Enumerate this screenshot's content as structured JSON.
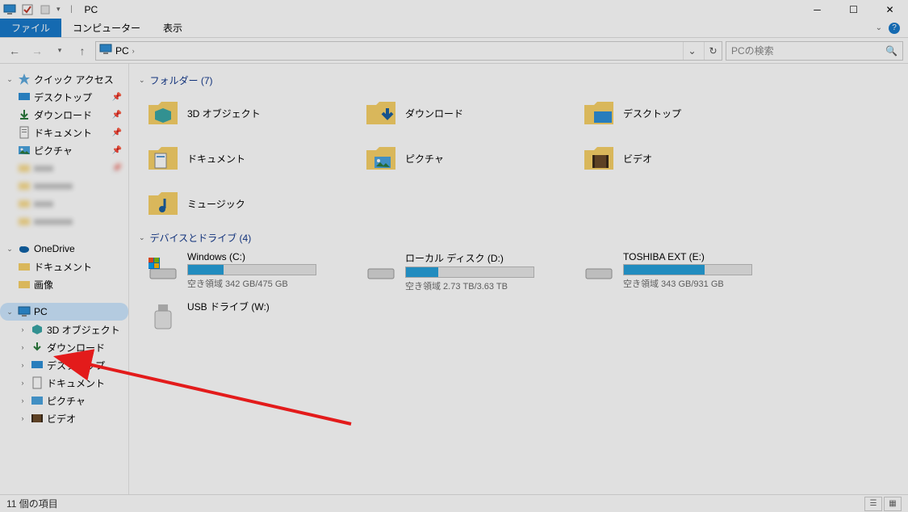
{
  "window": {
    "title": "PC"
  },
  "ribbon": {
    "file": "ファイル",
    "computer": "コンピューター",
    "view": "表示"
  },
  "nav": {
    "breadcrumb_root": "PC",
    "search_placeholder": "PCの検索"
  },
  "sidebar": {
    "quick_access": "クイック アクセス",
    "desktop": "デスクトップ",
    "downloads": "ダウンロード",
    "documents": "ドキュメント",
    "pictures": "ピクチャ",
    "blur1": "xxxx",
    "blur2": "xxxxxxxx",
    "blur3": "xxxx",
    "blur4": "xxxxxxxx",
    "onedrive": "OneDrive",
    "od_documents": "ドキュメント",
    "od_images": "画像",
    "pc": "PC",
    "pc_3d": "3D オブジェクト",
    "pc_downloads": "ダウンロード",
    "pc_desktop": "デスクトップ",
    "pc_documents": "ドキュメント",
    "pc_pictures": "ピクチャ",
    "pc_videos": "ビデオ"
  },
  "groups": {
    "folders": {
      "label": "フォルダー (7)"
    },
    "devices": {
      "label": "デバイスとドライブ (4)"
    }
  },
  "folders": {
    "f1": "3D オブジェクト",
    "f2": "ダウンロード",
    "f3": "デスクトップ",
    "f4": "ドキュメント",
    "f5": "ピクチャ",
    "f6": "ビデオ",
    "f7": "ミュージック"
  },
  "drives": {
    "d1": {
      "name": "Windows (C:)",
      "free": "空き領域 342 GB/475 GB",
      "pct": 28
    },
    "d2": {
      "name": "ローカル ディスク (D:)",
      "free": "空き領域 2.73 TB/3.63 TB",
      "pct": 25
    },
    "d3": {
      "name": "TOSHIBA EXT (E:)",
      "free": "空き領域 343 GB/931 GB",
      "pct": 63
    },
    "d4": {
      "name": "USB ドライブ (W:)",
      "free": ""
    }
  },
  "status": {
    "count": "11 個の項目"
  }
}
